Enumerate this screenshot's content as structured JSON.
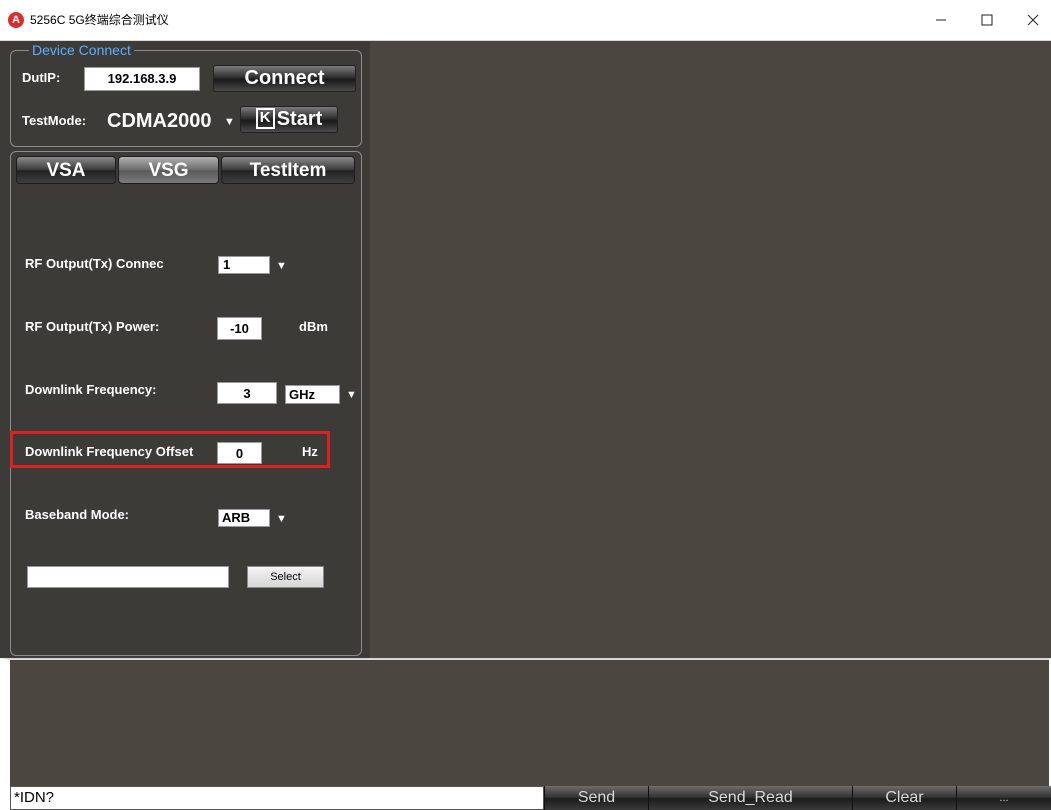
{
  "window": {
    "title": "5256C 5G终端综合测试仪",
    "logo_letter": "A",
    "minimize": "—",
    "maximize": "☐",
    "close": "✕"
  },
  "device_connect": {
    "legend": "Device Connect",
    "dut_ip_label": "DutIP:",
    "dut_ip_value": "192.168.3.9",
    "connect_label": "Connect",
    "test_mode_label": "TestMode:",
    "test_mode_value": "CDMA2000",
    "start_label": "Start"
  },
  "tabs": [
    {
      "label": "VSA",
      "active": false
    },
    {
      "label": "VSG",
      "active": true
    },
    {
      "label": "TestItem",
      "active": false
    }
  ],
  "vsg": {
    "rf_output_connector_label": "RF Output(Tx) Connec",
    "rf_output_connector_value": "1",
    "rf_output_power_label": "RF Output(Tx) Power:",
    "rf_output_power_value": "-10",
    "rf_output_power_unit": "dBm",
    "downlink_freq_label": "Downlink Frequency:",
    "downlink_freq_value": "3",
    "downlink_freq_unit": "GHz",
    "downlink_offset_label": "Downlink Frequency Offset",
    "downlink_offset_value": "0",
    "downlink_offset_unit": "Hz",
    "baseband_mode_label": "Baseband Mode:",
    "baseband_mode_value": "ARB",
    "file_path_value": "",
    "select_label": "Select"
  },
  "console": {
    "command_value": "*IDN?",
    "send_label": "Send",
    "send_read_label": "Send_Read",
    "clear_label": "Clear",
    "more_label": "..."
  },
  "colors": {
    "panel_bg": "#3d3b38",
    "display_bg": "#4b4740",
    "legend_blue": "#5aaeff",
    "highlight_red": "#e02020"
  }
}
